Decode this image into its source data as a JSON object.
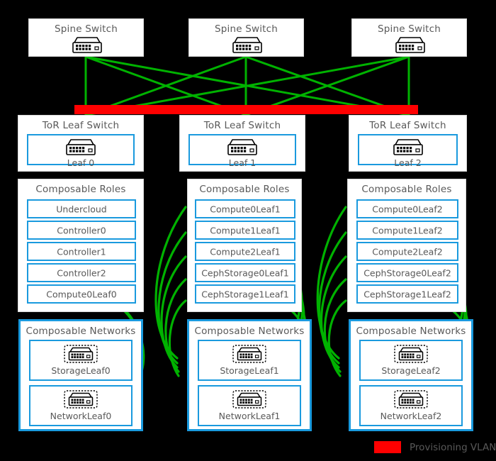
{
  "diagram": {
    "title": "Spine-Leaf composable network topology",
    "colors": {
      "link_green": "#00b200",
      "provisioning_red": "#ff0000",
      "box_blue": "#1a9ade",
      "text_gray": "#595959",
      "panel_white": "#ffffff",
      "background": "#000000"
    }
  },
  "spines": [
    {
      "title": "Spine Switch",
      "icon": "network-switch-icon"
    },
    {
      "title": "Spine Switch",
      "icon": "network-switch-icon"
    },
    {
      "title": "Spine Switch",
      "icon": "network-switch-icon"
    }
  ],
  "provisioning_bar": {
    "color": "#ff0000"
  },
  "leaves": [
    {
      "title": "ToR Leaf Switch",
      "name": "Leaf 0",
      "icon": "network-switch-icon"
    },
    {
      "title": "ToR Leaf Switch",
      "name": "Leaf 1",
      "icon": "network-switch-icon"
    },
    {
      "title": "ToR Leaf Switch",
      "name": "Leaf 2",
      "icon": "network-switch-icon"
    }
  ],
  "roles": [
    {
      "title": "Composable Roles",
      "items": [
        "Undercloud",
        "Controller0",
        "Controller1",
        "Controller2",
        "Compute0Leaf0"
      ]
    },
    {
      "title": "Composable Roles",
      "items": [
        "Compute0Leaf1",
        "Compute1Leaf1",
        "Compute2Leaf1",
        "CephStorage0Leaf1",
        "CephStorage1Leaf1"
      ]
    },
    {
      "title": "Composable Roles",
      "items": [
        "Compute0Leaf2",
        "Compute1Leaf2",
        "Compute2Leaf2",
        "CephStorage0Leaf2",
        "CephStorage1Leaf2"
      ]
    }
  ],
  "networks": [
    {
      "title": "Composable Networks",
      "items": [
        {
          "label": "StorageLeaf0",
          "icon": "network-switch-dashed-icon"
        },
        {
          "label": "NetworkLeaf0",
          "icon": "network-switch-dashed-icon"
        }
      ]
    },
    {
      "title": "Composable Networks",
      "items": [
        {
          "label": "StorageLeaf1",
          "icon": "network-switch-dashed-icon"
        },
        {
          "label": "NetworkLeaf1",
          "icon": "network-switch-dashed-icon"
        }
      ]
    },
    {
      "title": "Composable Networks",
      "items": [
        {
          "label": "StorageLeaf2",
          "icon": "network-switch-dashed-icon"
        },
        {
          "label": "NetworkLeaf2",
          "icon": "network-switch-dashed-icon"
        }
      ]
    }
  ],
  "legend": [
    {
      "label": "Provisioning VLAN",
      "color": "#ff0000",
      "swatch": "provisioning-vlan-swatch"
    }
  ]
}
